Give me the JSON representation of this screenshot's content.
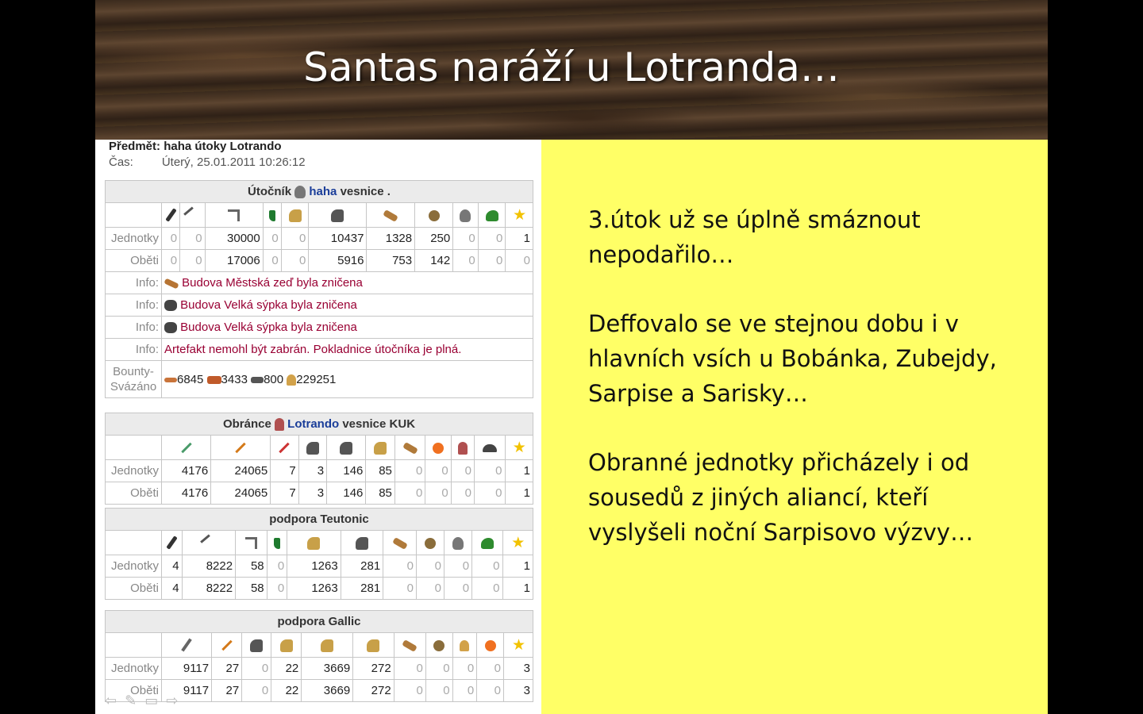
{
  "slide": {
    "title": "Santas naráží u Lotranda…",
    "paragraphs": [
      "3.útok už se úplně smáznout nepodařilo…",
      "Deffovalo se ve stejnou dobu i v hlavních vsích u Bobánka, Zubejdy, Sarpise a Sarisky…",
      "Obranné jednotky přicházely i od sousedů z jiných aliancí, kteří vyslyšeli noční Sarpisovo výzvy…"
    ]
  },
  "report": {
    "subject_label": "Předmět:",
    "subject": "haha útoky Lotrando",
    "time_label": "Čas:",
    "time": "Úterý, 25.01.2011 10:26:12",
    "labels": {
      "units": "Jednotky",
      "casualties": "Oběti",
      "info": "Info:",
      "bounty1": "Bounty-",
      "bounty2": "Svázáno"
    },
    "attacker": {
      "prefix": "Útočník",
      "player": "haha",
      "village": "vesnice .",
      "icons": [
        "club-icon",
        "spear-icon",
        "axe-icon",
        "scout-icon",
        "paladin-horse-icon",
        "teutonic-knight-icon",
        "ram-icon",
        "catapult-icon",
        "chief-icon",
        "settler-icon",
        "hero-star-icon"
      ],
      "units": [
        "0",
        "0",
        "30000",
        "0",
        "0",
        "10437",
        "1328",
        "250",
        "0",
        "0",
        "1"
      ],
      "casualties": [
        "0",
        "0",
        "17006",
        "0",
        "0",
        "5916",
        "753",
        "142",
        "0",
        "0",
        "0"
      ],
      "infos": [
        {
          "icon": "wall-icon",
          "text": "Budova Městská zeď byla zničena"
        },
        {
          "icon": "granary-icon",
          "text": "Budova Velká sýpka byla zničena"
        },
        {
          "icon": "granary-icon",
          "text": "Budova Velká sýpka byla zničena"
        },
        {
          "icon": "",
          "text": "Artefakt nemohl být zabrán. Pokladnice útočníka je plná."
        }
      ],
      "bounty": [
        "6845",
        "3433",
        "800",
        "229251"
      ]
    },
    "defender": {
      "prefix": "Obránce",
      "player": "Lotrando",
      "village": "vesnice KUK",
      "units": [
        "4176",
        "24065",
        "7",
        "3",
        "146",
        "85",
        "0",
        "0",
        "0",
        "0",
        "1"
      ],
      "casualties": [
        "4176",
        "24065",
        "7",
        "3",
        "146",
        "85",
        "0",
        "0",
        "0",
        "0",
        "1"
      ]
    },
    "teutonic": {
      "title": "podpora Teutonic",
      "units": [
        "4",
        "8222",
        "58",
        "0",
        "1263",
        "281",
        "0",
        "0",
        "0",
        "0",
        "1"
      ],
      "casualties": [
        "4",
        "8222",
        "58",
        "0",
        "1263",
        "281",
        "0",
        "0",
        "0",
        "0",
        "1"
      ]
    },
    "gallic": {
      "title": "podpora Gallic",
      "units": [
        "9117",
        "27",
        "0",
        "22",
        "3669",
        "272",
        "0",
        "0",
        "0",
        "0",
        "3"
      ],
      "casualties": [
        "9117",
        "27",
        "0",
        "22",
        "3669",
        "272",
        "0",
        "0",
        "0",
        "0",
        "3"
      ]
    }
  }
}
